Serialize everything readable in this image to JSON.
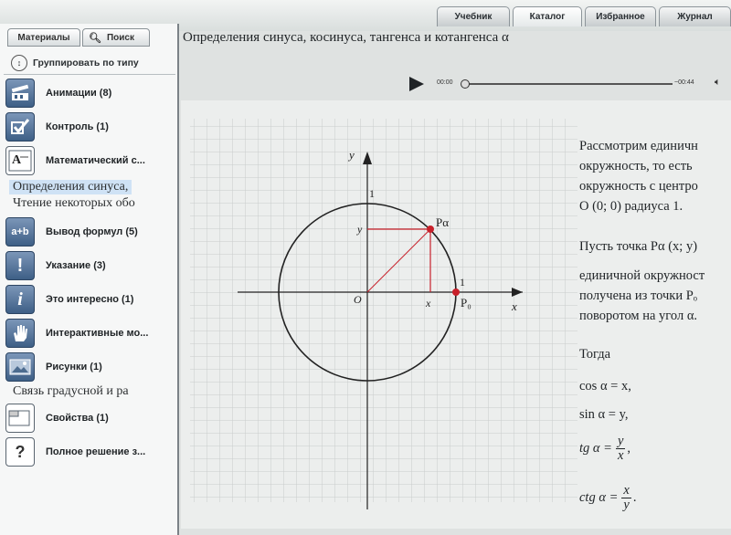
{
  "top_tabs": [
    "Учебник",
    "Каталог",
    "Избранное",
    "Журнал"
  ],
  "sidebar": {
    "tabs": [
      "Материалы",
      "Поиск"
    ],
    "group_by": "Группировать по типу",
    "items": [
      {
        "label": "Анимации (8)",
        "icon": "film-icon"
      },
      {
        "label": "Контроль (1)",
        "icon": "checkmark-icon"
      },
      {
        "label": "Математический с...",
        "icon": "text-A-icon"
      },
      {
        "label": "Вывод формул (5)",
        "icon": "formula-icon",
        "glyph": "a+b"
      },
      {
        "label": "Указание (3)",
        "icon": "exclamation-icon",
        "glyph": "!"
      },
      {
        "label": "Это интересно (1)",
        "icon": "info-icon",
        "glyph": "i"
      },
      {
        "label": "Интерактивные мо...",
        "icon": "hand-icon"
      },
      {
        "label": "Рисунки (1)",
        "icon": "picture-icon"
      },
      {
        "label": "Свойства (1)",
        "icon": "properties-icon"
      },
      {
        "label": "Полное решение з...",
        "icon": "question-icon",
        "glyph": "?"
      }
    ],
    "subitems": [
      "Определения синуса,",
      "Чтение некоторых обо",
      "Связь градусной и ра"
    ]
  },
  "title": "Определения синуса, косинуса, тангенса и котангенса α",
  "player": {
    "current": "00:00",
    "total": "~00:44"
  },
  "diagram": {
    "x_axis": "x",
    "y_axis": "y",
    "origin": "O",
    "one_y": "1",
    "one_x": "1",
    "point_a": "Pα",
    "point_0": "P₀",
    "tick_x": "x",
    "tick_y": "y"
  },
  "text": {
    "p1": [
      "Рассмотрим единичн",
      "окружность, то есть",
      "окружность с центро",
      "O (0; 0) радиуса 1."
    ],
    "p2": [
      "Пусть точка Pα (x; y)",
      "единичной окружност",
      "получена из точки Pₒ",
      "поворотом на угол α."
    ],
    "then": "Тогда",
    "cos": "cos α = x,",
    "sin": "sin α = y,",
    "tg_lhs": "tg α =",
    "tg_num": "y",
    "tg_den": "x",
    "ctg_lhs": "ctg α =",
    "ctg_num": "x",
    "ctg_den": "y"
  },
  "colors": {
    "accent_red": "#c8202a",
    "grid": "#c9cccc"
  }
}
